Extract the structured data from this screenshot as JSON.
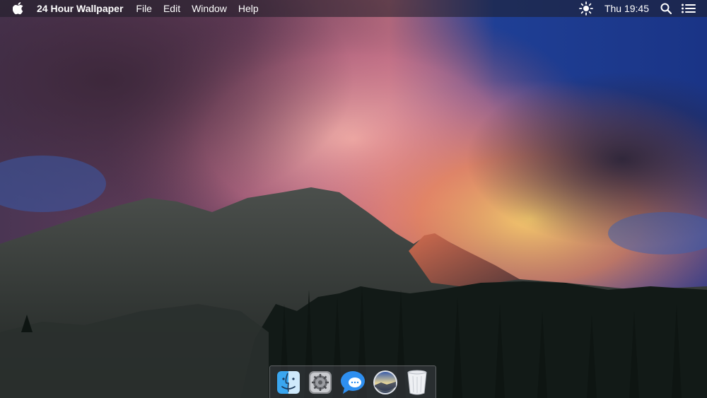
{
  "menubar": {
    "app_name": "24 Hour Wallpaper",
    "menus": [
      "File",
      "Edit",
      "Window",
      "Help"
    ],
    "clock": "Thu 19:45",
    "icons": {
      "apple": "apple-logo-icon",
      "brightness": "sun-icon",
      "search": "search-icon",
      "notifications": "list-icon"
    }
  },
  "dock": {
    "items": [
      {
        "name": "Finder",
        "icon": "finder-icon"
      },
      {
        "name": "System Preferences",
        "icon": "gear-icon"
      },
      {
        "name": "Messages",
        "icon": "messages-icon"
      },
      {
        "name": "24 Hour Wallpaper",
        "icon": "wallpaper-app-icon"
      },
      {
        "name": "Trash",
        "icon": "trash-icon"
      }
    ]
  },
  "colors": {
    "sky_blue": "#1d3f8f",
    "cloud_pink": "#d98a93",
    "cloud_orange": "#f2a24e",
    "mountain_dark": "#2a2d2c"
  }
}
